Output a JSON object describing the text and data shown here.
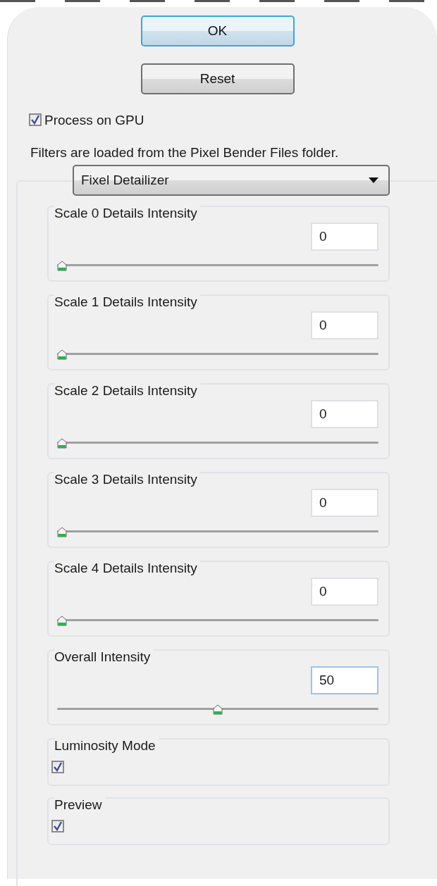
{
  "buttons": [
    {
      "label": "OK",
      "default": true
    },
    {
      "label": "Reset",
      "default": false
    }
  ],
  "gpu": {
    "label": "Process on GPU",
    "checked": true
  },
  "note": "Filters are loaded from the Pixel Bender Files folder.",
  "filter": {
    "value": "Fixel Detailizer"
  },
  "sections": [
    {
      "kind": "slider",
      "label": "Scale 0 Details Intensity",
      "value": "0",
      "level": 0
    },
    {
      "kind": "slider",
      "label": "Scale 1 Details Intensity",
      "value": "0",
      "level": 0
    },
    {
      "kind": "slider",
      "label": "Scale 2 Details Intensity",
      "value": "0",
      "level": 0
    },
    {
      "kind": "slider",
      "label": "Scale 3 Details Intensity",
      "value": "0",
      "level": 0
    },
    {
      "kind": "slider",
      "label": "Scale 4 Details Intensity",
      "value": "0",
      "level": 0
    },
    {
      "kind": "slider",
      "label": "Overall Intensity",
      "value": "50",
      "level": 0.5
    },
    {
      "kind": "checkbox",
      "label": "Luminosity Mode",
      "checked": true
    },
    {
      "kind": "checkbox",
      "label": "Preview",
      "checked": true
    }
  ]
}
